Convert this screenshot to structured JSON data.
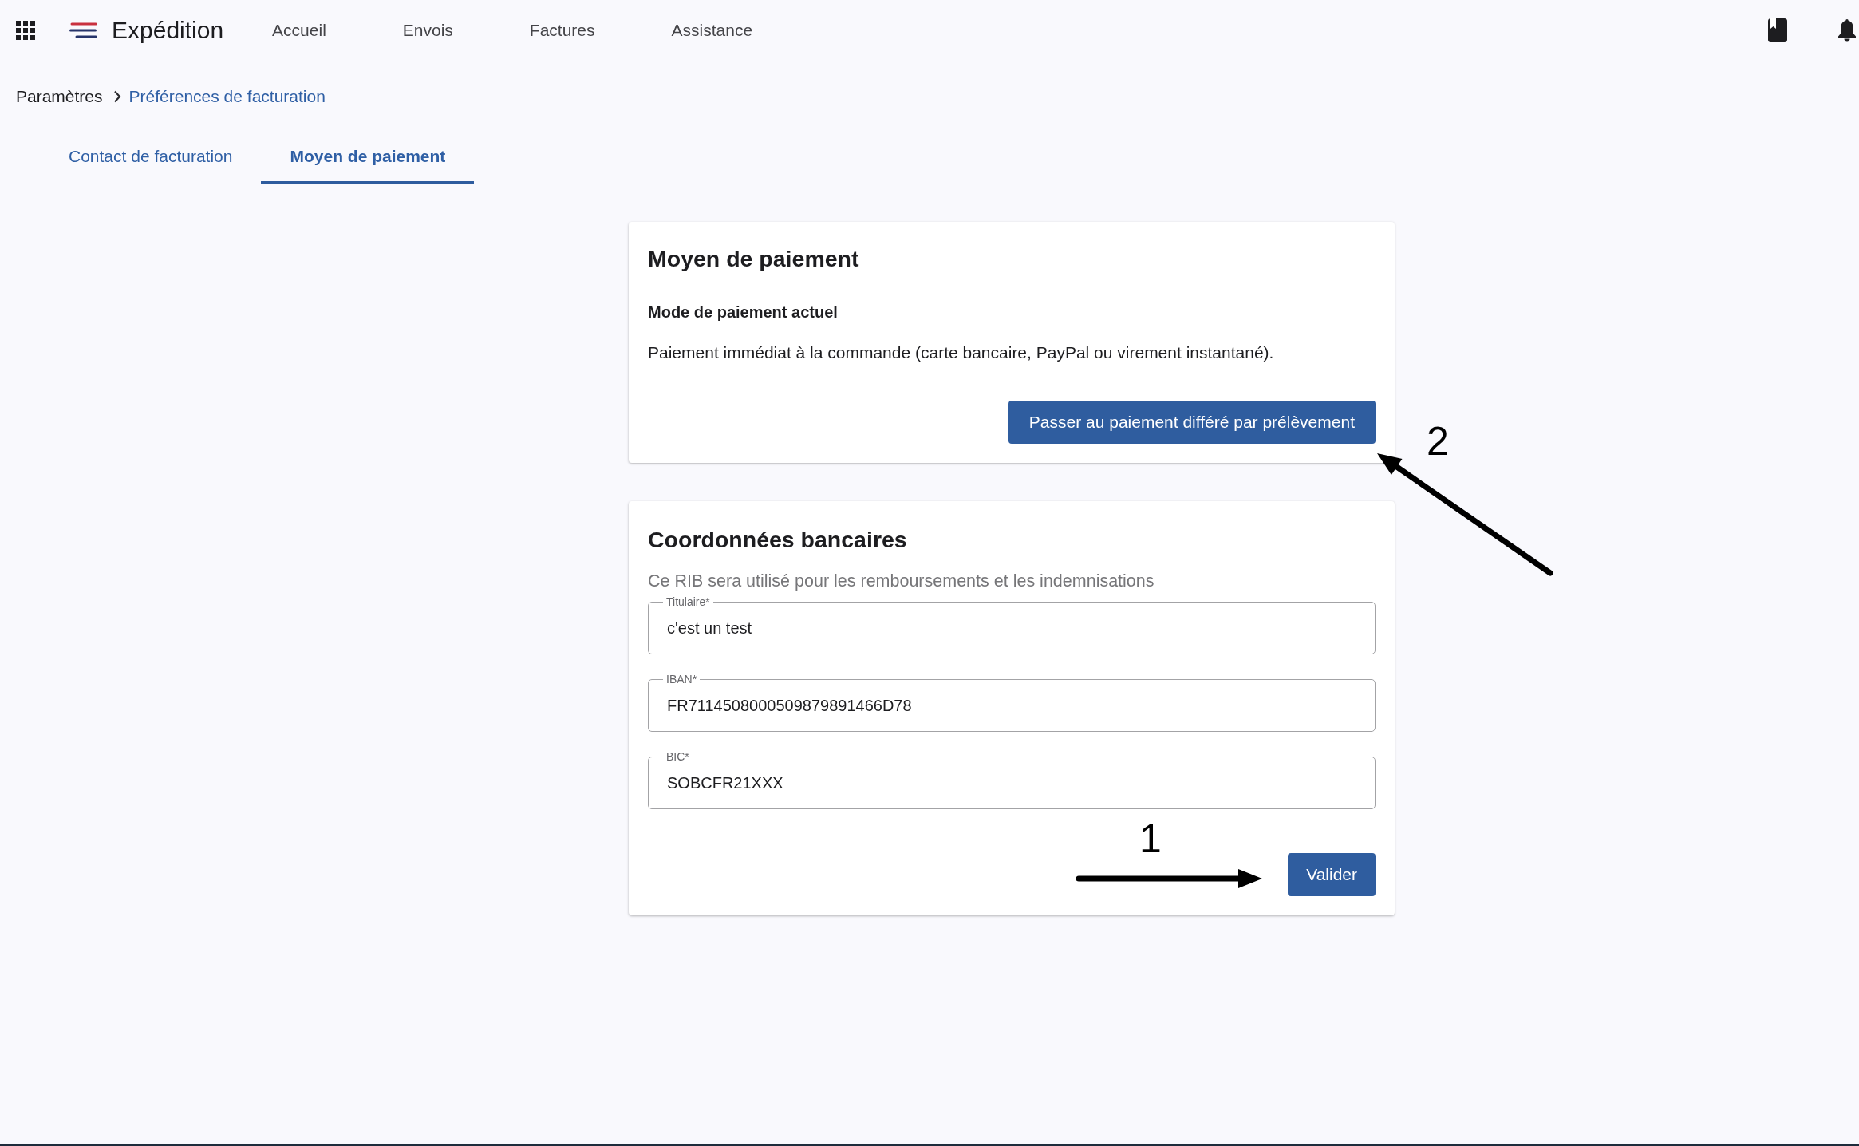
{
  "app_bar": {
    "title": "Expédition",
    "nav": [
      "Accueil",
      "Envois",
      "Factures",
      "Assistance"
    ]
  },
  "breadcrumb": [
    {
      "label": "Paramètres",
      "kind": "text"
    },
    {
      "label": "Préférences de facturation",
      "kind": "link"
    }
  ],
  "tabs": [
    {
      "label": "Contact de facturation",
      "selected": false
    },
    {
      "label": "Moyen de paiement",
      "selected": true
    }
  ],
  "payment_method_card": {
    "title": "Moyen de paiement",
    "section_title": "Mode de paiement actuel",
    "description": "Paiement immédiat à la commande (carte bancaire, PayPal ou virement instantané).",
    "button": "Passer au paiement différé par prélèvement"
  },
  "bank_details_card": {
    "title": "Coordonnées bancaires",
    "hint": "Ce RIB sera utilisé pour les remboursements et les indemnisations",
    "fields": [
      {
        "label": "Titulaire*",
        "value": "c'est un test"
      },
      {
        "label": "IBAN*",
        "value": "FR7114508000509879891466D78"
      },
      {
        "label": "BIC*",
        "value": "SOBCFR21XXX"
      }
    ],
    "button": "Valider"
  },
  "annotations": [
    {
      "label": "2"
    },
    {
      "label": "1"
    }
  ]
}
